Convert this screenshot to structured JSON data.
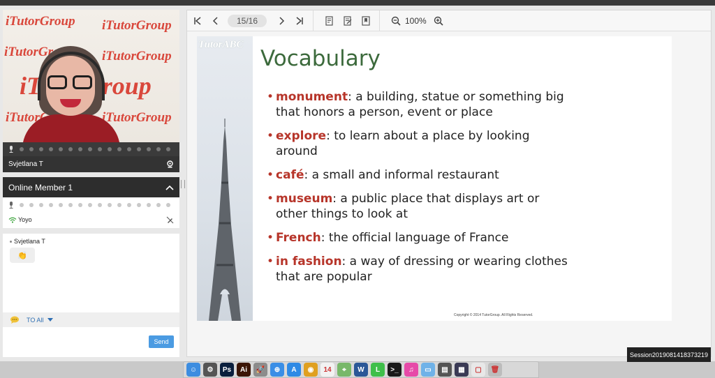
{
  "video": {
    "background_brand": "iTutorGroup",
    "participant_name": "Svjetlana T"
  },
  "members": {
    "header_label": "Online Member 1",
    "items": [
      {
        "name": "Yoyo"
      }
    ]
  },
  "chat": {
    "messages": [
      {
        "from": "Svjetlana T",
        "content": "👏"
      }
    ],
    "recipient_label": "TO All",
    "send_label": "Send"
  },
  "viewer": {
    "page_indicator": "15/16",
    "zoom_label": "100%"
  },
  "slide": {
    "brand": "TutorABC",
    "title": "Vocabulary",
    "items": [
      {
        "term": "monument",
        "definition": ": a building, statue or something big that honors a person, event or place"
      },
      {
        "term": "explore",
        "definition": ": to learn about a place by looking around"
      },
      {
        "term": "café",
        "definition": ": a small and informal restaurant"
      },
      {
        "term": "museum",
        "definition": ": a public place that displays art or other things to look at"
      },
      {
        "term": "French",
        "definition": ": the official language of France"
      },
      {
        "term": "in fashion",
        "definition": ": a way of dressing or wearing clothes that are popular"
      }
    ],
    "copyright": "Copyright © 2014 TutorGroup. All Rights Reserved."
  },
  "session_label": "Session2019081418373219",
  "dock": {
    "icons": [
      {
        "name": "finder-icon",
        "color": "#3d8de0",
        "glyph": "☺"
      },
      {
        "name": "system-preferences-icon",
        "color": "#555555",
        "glyph": "⚙"
      },
      {
        "name": "photoshop-icon",
        "color": "#0a1f3d",
        "glyph": "Ps"
      },
      {
        "name": "illustrator-icon",
        "color": "#3b1505",
        "glyph": "Ai"
      },
      {
        "name": "launchpad-icon",
        "color": "#8c8c8c",
        "glyph": "🚀"
      },
      {
        "name": "safari-icon",
        "color": "#3a8ee6",
        "glyph": "⊕"
      },
      {
        "name": "app-store-icon",
        "color": "#2f8ae5",
        "glyph": "A"
      },
      {
        "name": "chrome-icon",
        "color": "#e0a020",
        "glyph": "◉"
      },
      {
        "name": "calendar-icon",
        "color": "#f2f2f2",
        "glyph": "14"
      },
      {
        "name": "maps-icon",
        "color": "#78b86a",
        "glyph": "⌖"
      },
      {
        "name": "word-icon",
        "color": "#2b5797",
        "glyph": "W"
      },
      {
        "name": "line-icon",
        "color": "#3fbf4a",
        "glyph": "L"
      },
      {
        "name": "terminal-icon",
        "color": "#1a1a1a",
        "glyph": ">_"
      },
      {
        "name": "itunes-icon",
        "color": "#e64aa8",
        "glyph": "♫"
      },
      {
        "name": "folder-icon",
        "color": "#6fb2e8",
        "glyph": "▭"
      },
      {
        "name": "document-icon",
        "color": "#555555",
        "glyph": "▤"
      },
      {
        "name": "screen-thumbnail-icon",
        "color": "#3a3a55",
        "glyph": "▦"
      },
      {
        "name": "window-thumbnail-icon",
        "color": "#e8e8e8",
        "glyph": "▢"
      },
      {
        "name": "trash-icon",
        "color": "#bcbcbc",
        "glyph": "🗑"
      }
    ]
  }
}
